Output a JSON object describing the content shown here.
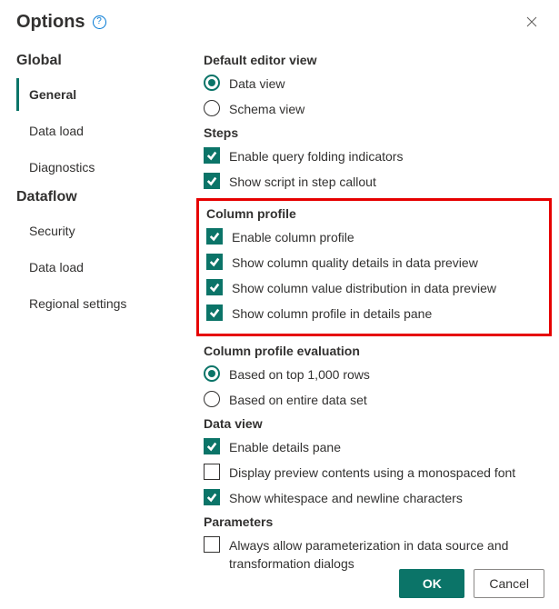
{
  "dialog": {
    "title": "Options",
    "help_icon": "?"
  },
  "sidebar": {
    "groups": [
      {
        "header": "Global",
        "items": [
          {
            "label": "General",
            "selected": true
          },
          {
            "label": "Data load",
            "selected": false
          },
          {
            "label": "Diagnostics",
            "selected": false
          }
        ]
      },
      {
        "header": "Dataflow",
        "items": [
          {
            "label": "Security",
            "selected": false
          },
          {
            "label": "Data load",
            "selected": false
          },
          {
            "label": "Regional settings",
            "selected": false
          }
        ]
      }
    ]
  },
  "content": {
    "default_editor_view": {
      "header": "Default editor view",
      "options": [
        {
          "label": "Data view",
          "checked": true
        },
        {
          "label": "Schema view",
          "checked": false
        }
      ]
    },
    "steps": {
      "header": "Steps",
      "options": [
        {
          "label": "Enable query folding indicators",
          "checked": true
        },
        {
          "label": "Show script in step callout",
          "checked": true
        }
      ]
    },
    "column_profile": {
      "header": "Column profile",
      "options": [
        {
          "label": "Enable column profile",
          "checked": true
        },
        {
          "label": "Show column quality details in data preview",
          "checked": true
        },
        {
          "label": "Show column value distribution in data preview",
          "checked": true
        },
        {
          "label": "Show column profile in details pane",
          "checked": true
        }
      ]
    },
    "column_profile_evaluation": {
      "header": "Column profile evaluation",
      "options": [
        {
          "label": "Based on top 1,000 rows",
          "checked": true
        },
        {
          "label": "Based on entire data set",
          "checked": false
        }
      ]
    },
    "data_view": {
      "header": "Data view",
      "options": [
        {
          "label": "Enable details pane",
          "checked": true
        },
        {
          "label": "Display preview contents using a monospaced font",
          "checked": false
        },
        {
          "label": "Show whitespace and newline characters",
          "checked": true
        }
      ]
    },
    "parameters": {
      "header": "Parameters",
      "options": [
        {
          "label": "Always allow parameterization in data source and transformation dialogs",
          "checked": false
        }
      ]
    }
  },
  "footer": {
    "ok": "OK",
    "cancel": "Cancel"
  }
}
